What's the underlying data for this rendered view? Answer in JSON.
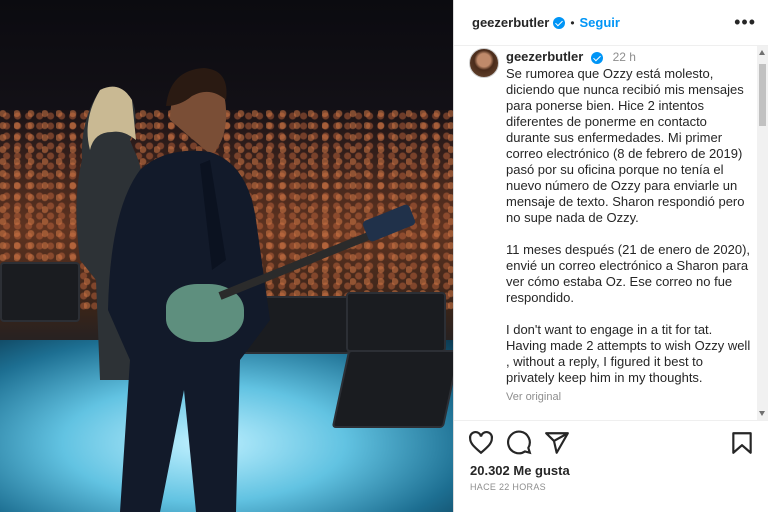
{
  "post": {
    "username": "geezerbutler",
    "follow_label": "Seguir",
    "more_label": "•••",
    "time_ago": "22 h",
    "caption_paragraphs": [
      "Se rumorea que Ozzy está molesto, diciendo que nunca recibió mis mensajes para ponerse bien. Hice 2 intentos diferentes de ponerme en contacto durante sus enfermedades. Mi primer correo electrónico (8 de febrero de 2019) pasó por su oficina porque no tenía el nuevo número de Ozzy para enviarle un mensaje de texto. Sharon respondió pero no supe nada de Ozzy.",
      "11 meses después (21 de enero de 2020), envié un correo electrónico a Sharon para ver cómo estaba Oz. Ese correo no fue respondido.",
      "I don't want to engage in a tit for tat. Having made 2 attempts to wish Ozzy well , without a reply, I figured it best to privately keep him in my thoughts."
    ],
    "see_original": "Ver original",
    "likes": "20.302 Me gusta",
    "posted": "HACE 22 HORAS"
  },
  "icons": {
    "like": "heart-icon",
    "comment": "comment-icon",
    "share": "paper-plane-icon",
    "save": "bookmark-icon",
    "verified": "verified-badge-icon"
  },
  "colors": {
    "accent": "#0095f6",
    "text": "#262626",
    "muted": "#8e8e8e"
  }
}
